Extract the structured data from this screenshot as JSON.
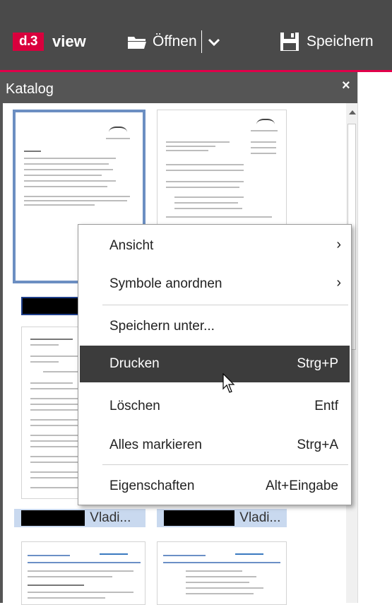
{
  "toolbar": {
    "logo_badge": "d.3",
    "logo_word": "view",
    "open_label": "Öffnen",
    "save_label": "Speichern",
    "icons": [
      "folder-open-icon",
      "chevron-down-icon",
      "floppy-disk-icon"
    ]
  },
  "catalog": {
    "title": "Katalog",
    "close_symbol": "×",
    "items": [
      {
        "caption": "",
        "selected": true
      },
      {
        "caption": "",
        "selected": false
      },
      {
        "caption": "Vladi...",
        "selected": false
      },
      {
        "caption": "Vladi...",
        "selected": false
      },
      {
        "caption": "",
        "selected": false
      },
      {
        "caption": "",
        "selected": false
      }
    ]
  },
  "context_menu": {
    "items": [
      {
        "label": "Ansicht",
        "shortcut": "",
        "submenu": true
      },
      {
        "label": "Symbole anordnen",
        "shortcut": "",
        "submenu": true
      },
      {
        "label": "Speichern unter...",
        "shortcut": "",
        "submenu": false
      },
      {
        "label": "Drucken",
        "shortcut": "Strg+P",
        "submenu": false,
        "highlighted": true
      },
      {
        "label": "Löschen",
        "shortcut": "Entf",
        "submenu": false
      },
      {
        "label": "Alles markieren",
        "shortcut": "Strg+A",
        "submenu": false
      },
      {
        "label": "Eigenschaften",
        "shortcut": "Alt+Eingabe",
        "submenu": false
      }
    ],
    "submenu_arrow": "›"
  },
  "colors": {
    "toolbar_bg": "#4a4a4a",
    "accent": "#e1004a",
    "selection_border": "#6c8fc2",
    "caption_bg": "#c9d9ef",
    "highlight_bg": "#3c3c3c"
  }
}
